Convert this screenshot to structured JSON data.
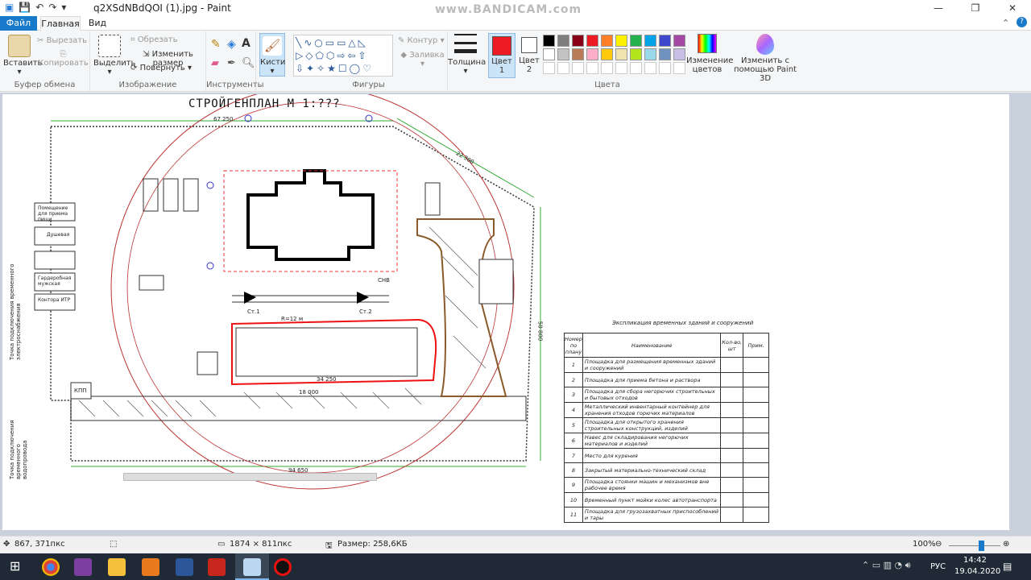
{
  "window": {
    "title": "q2XSdNBdQOI (1).jpg - Paint",
    "watermark": "www.BANDICAM.com",
    "controls": [
      "—",
      "❐",
      "✕"
    ]
  },
  "tabs": {
    "file": "Файл",
    "home": "Главная",
    "view": "Вид"
  },
  "ribbon": {
    "clipboard": {
      "label": "Буфер обмена",
      "paste": "Вставить",
      "cut": "Вырезать",
      "copy": "Копировать"
    },
    "image": {
      "label": "Изображение",
      "select": "Выделить",
      "crop": "Обрезать",
      "resize": "Изменить размер",
      "rotate": "Повернуть"
    },
    "tools": {
      "label": "Инструменты"
    },
    "brushes": {
      "label": "Кисти"
    },
    "shapes": {
      "label": "Фигуры",
      "outline": "Контур",
      "fill": "Заливка"
    },
    "size": {
      "label": "Толщина"
    },
    "color1": {
      "label": "Цвет",
      "num": "1",
      "value": "#ed1c24"
    },
    "color2": {
      "label": "Цвет",
      "num": "2",
      "value": "#ffffff"
    },
    "colors": {
      "label": "Цвета",
      "edit": "Изменение цветов",
      "paint3d": "Изменить с помощью Paint 3D"
    },
    "palette_row1": [
      "#000000",
      "#7f7f7f",
      "#880015",
      "#ed1c24",
      "#ff7f27",
      "#fff200",
      "#22b14c",
      "#00a2e8",
      "#3f48cc",
      "#a349a4"
    ],
    "palette_row2": [
      "#ffffff",
      "#c3c3c3",
      "#b97a57",
      "#ffaec9",
      "#ffc90e",
      "#efe4b0",
      "#b5e61d",
      "#99d9ea",
      "#7092be",
      "#c8bfe7"
    ]
  },
  "drawing": {
    "title": "СТРОЙГЕНПЛАН  М 1:???",
    "dims": {
      "top": "67 250",
      "bottom": "94 650",
      "right": "50 800",
      "diag": "22 300",
      "inner1": "18 000",
      "inner2": "34 250",
      "r": "R=12 м"
    },
    "labels": [
      "Помещение для приема пищи",
      "Душевая",
      "Гардеробная мужская",
      "Контора ИТР",
      "КПП",
      "СНВ",
      "Ст.1",
      "Ст.2"
    ],
    "side_text1": "Точка подключения временного электроснабжения",
    "side_text2": "Точка подключения временного водопровода"
  },
  "explication": {
    "caption": "Экспликация временных зданий и сооружений",
    "headers": [
      "Номер по плану",
      "Наименование",
      "Кол-во, шт",
      "Прим."
    ],
    "rows": [
      [
        "1",
        "Площадка для размещения временных зданий и сооружений"
      ],
      [
        "2",
        "Площадка для приема бетона и раствора"
      ],
      [
        "3",
        "Площадка для сбора негорючих строительных и бытовых отходов"
      ],
      [
        "4",
        "Металлический инвентарный контейнер для хранения отходов горючих материалов"
      ],
      [
        "5",
        "Площадка для открытого хранения строительных конструкций, изделий"
      ],
      [
        "6",
        "Навес для складирования негорючих материалов и изделий"
      ],
      [
        "7",
        "Место для курения"
      ],
      [
        "8",
        "Закрытый материально-технический склад"
      ],
      [
        "9",
        "Площадка стоянки машин и механизмов вне рабочее время"
      ],
      [
        "10",
        "Временный пункт мойки колес автотранспорта"
      ],
      [
        "11",
        "Площадка для грузозахватных приспособлений и тары"
      ]
    ]
  },
  "status": {
    "cursor": "867, 371пкс",
    "dims": "1874 × 811пкс",
    "size": "Размер: 258,6КБ",
    "zoom": "100%"
  },
  "taskbar": {
    "lang": "РУС",
    "time": "14:42",
    "date": "19.04.2020"
  }
}
